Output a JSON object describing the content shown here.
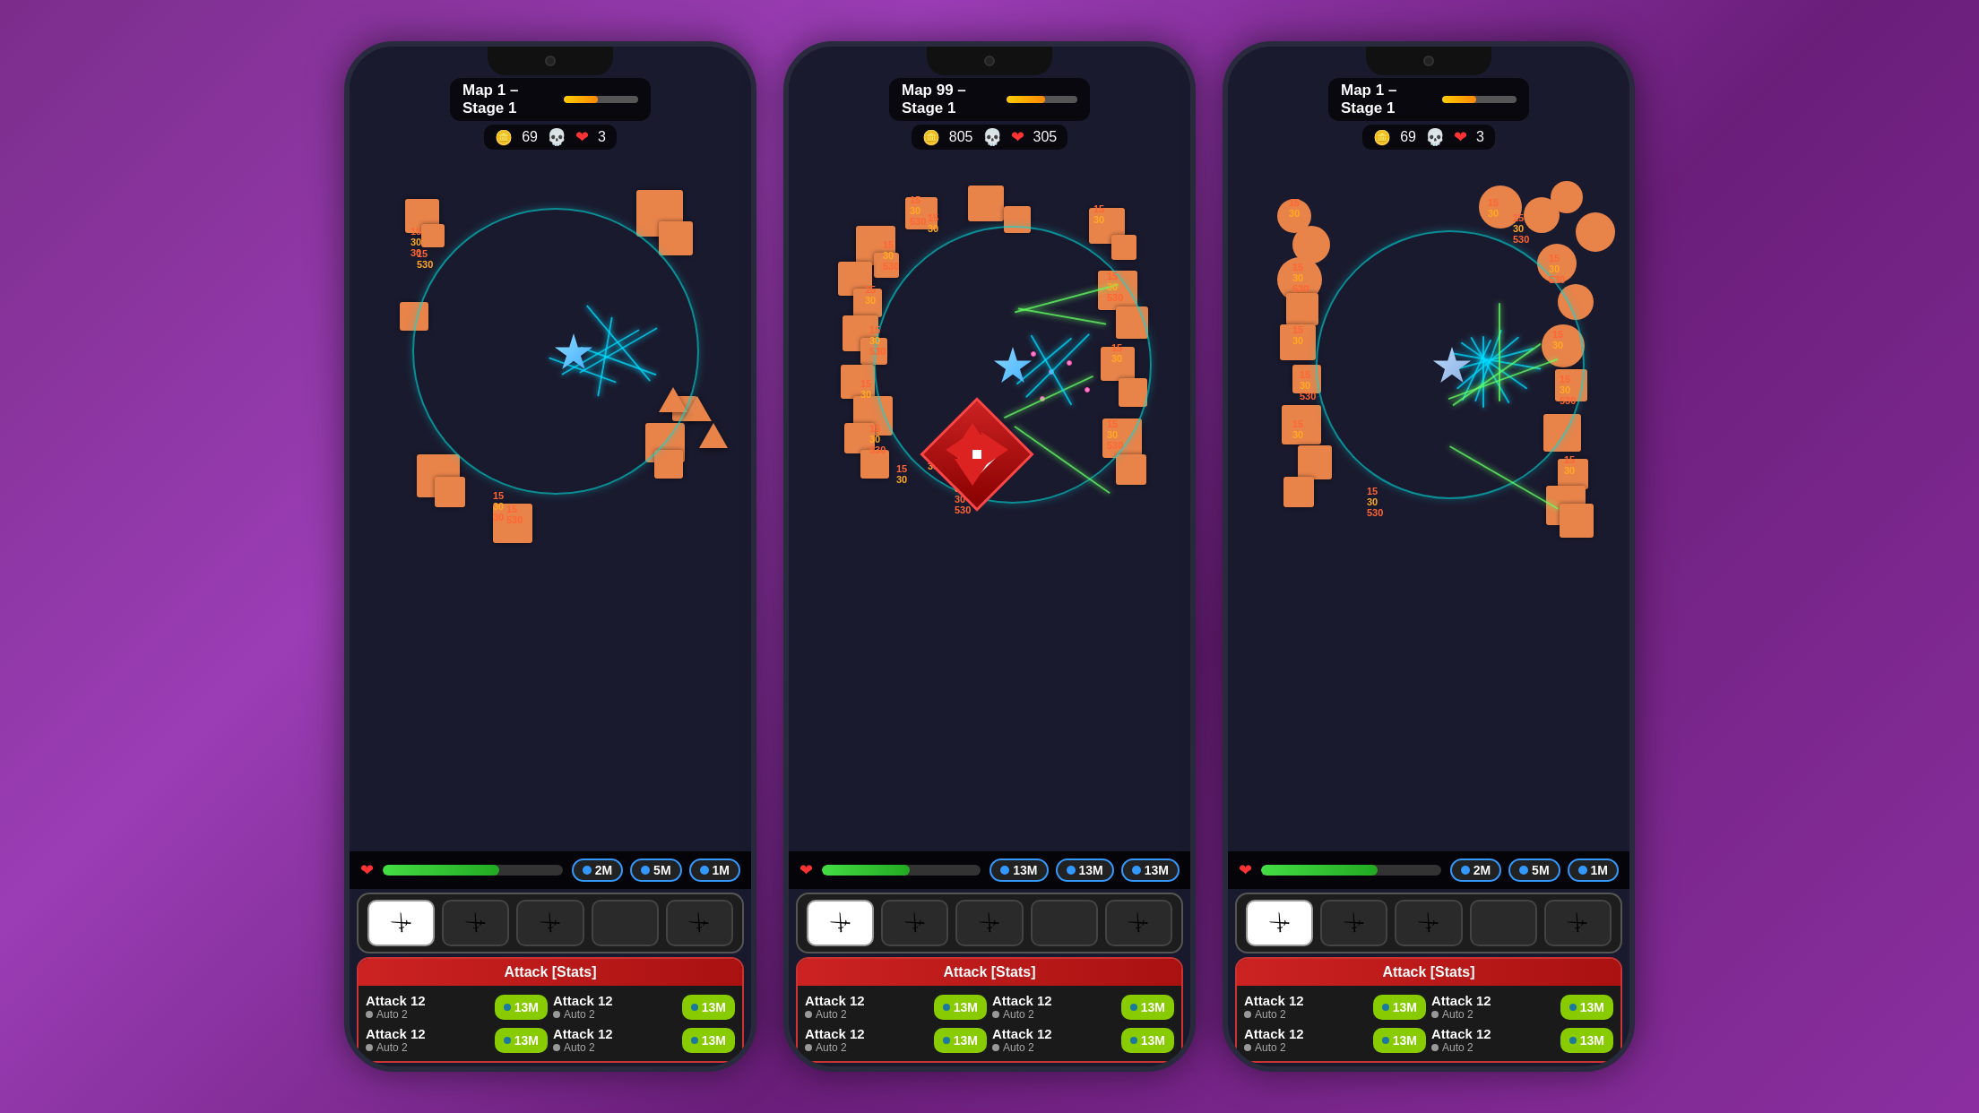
{
  "phones": [
    {
      "id": "phone-left",
      "map": "Map 1 – Stage 1",
      "xp_percent": 45,
      "coins": "69",
      "hearts": "3",
      "hp_percent": 65,
      "resources": [
        "2M",
        "5M",
        "1M"
      ],
      "weapon_count": 4,
      "active_weapon": 0,
      "stats_header": "Attack [Stats]",
      "stats": [
        {
          "name": "Attack 12",
          "sub": "Auto  2",
          "btn": "13M"
        },
        {
          "name": "Attack 12",
          "sub": "Auto  2",
          "btn": "13M"
        },
        {
          "name": "Attack 12",
          "sub": "Auto  2",
          "btn": "13M"
        },
        {
          "name": "Attack 12",
          "sub": "Auto  2",
          "btn": "13M"
        }
      ],
      "variant": "sparse"
    },
    {
      "id": "phone-center",
      "map": "Map 99 – Stage 1",
      "xp_percent": 55,
      "coins": "805",
      "hearts": "305",
      "hp_percent": 55,
      "resources": [
        "13M",
        "13M",
        "13M"
      ],
      "weapon_count": 4,
      "active_weapon": 0,
      "stats_header": "Attack [Stats]",
      "stats": [
        {
          "name": "Attack 12",
          "sub": "Auto  2",
          "btn": "13M"
        },
        {
          "name": "Attack 12",
          "sub": "Auto  2",
          "btn": "13M"
        },
        {
          "name": "Attack 12",
          "sub": "Auto  2",
          "btn": "13M"
        },
        {
          "name": "Attack 12",
          "sub": "Auto  2",
          "btn": "13M"
        }
      ],
      "variant": "crowded"
    },
    {
      "id": "phone-right",
      "map": "Map 1 – Stage 1",
      "xp_percent": 45,
      "coins": "69",
      "hearts": "3",
      "hp_percent": 65,
      "resources": [
        "2M",
        "5M",
        "1M"
      ],
      "weapon_count": 4,
      "active_weapon": 0,
      "stats_header": "Attack [Stats]",
      "stats": [
        {
          "name": "Attack 12",
          "sub": "Auto  2",
          "btn": "13M"
        },
        {
          "name": "Attack 12",
          "sub": "Auto  2",
          "btn": "13M"
        },
        {
          "name": "Attack 12",
          "sub": "Auto  2",
          "btn": "13M"
        },
        {
          "name": "Attack 12",
          "sub": "Auto  2",
          "btn": "13M"
        }
      ],
      "variant": "crowded2"
    }
  ],
  "icons": {
    "sword": "⚔",
    "coin": "🪙",
    "skull": "💀",
    "heart": "❤",
    "dot": "●"
  }
}
